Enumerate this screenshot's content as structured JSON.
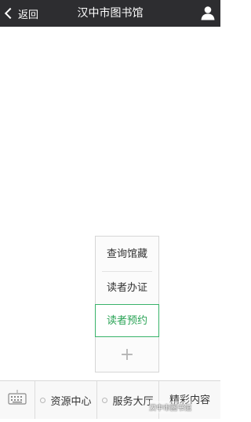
{
  "nav": {
    "back_label": "返回",
    "title": "汉中市图书馆"
  },
  "popup": {
    "items": [
      {
        "label": "查询馆藏"
      },
      {
        "label": "读者办证"
      },
      {
        "label": "读者预约",
        "active": true
      }
    ],
    "add_symbol": "+"
  },
  "menubar": {
    "items": [
      {
        "label": "资源中心"
      },
      {
        "label": "服务大厅"
      },
      {
        "label": "精彩内容"
      }
    ]
  },
  "watermark": "汉中市图书馆",
  "colors": {
    "nav_bg": "#2d2d30",
    "active_green": "#2aa356"
  }
}
